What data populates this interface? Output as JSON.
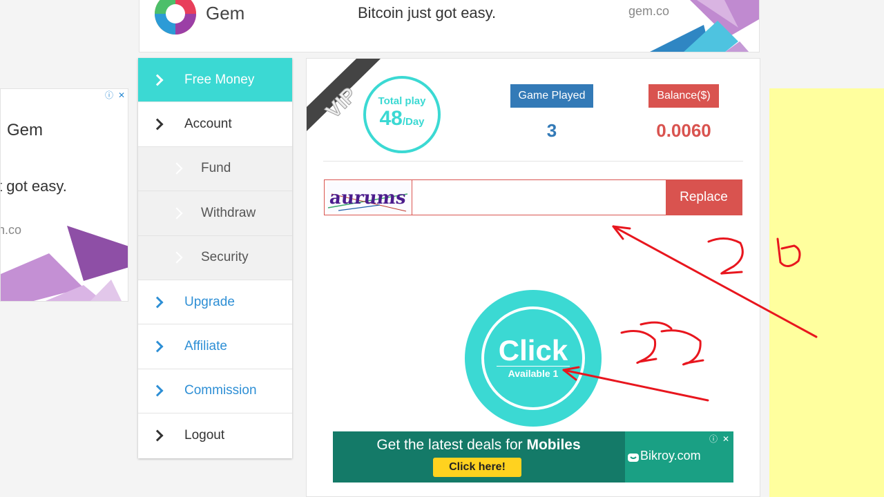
{
  "top_ad": {
    "brand": "Gem",
    "slogan": "Bitcoin just got easy.",
    "domain": "gem.co"
  },
  "left_ad": {
    "brand": "Gem",
    "slogan": "t got easy.",
    "domain": "n.co",
    "adchoices": [
      "ⓘ",
      "✕"
    ]
  },
  "sidebar": {
    "items": [
      {
        "label": "Free Money"
      },
      {
        "label": "Account"
      },
      {
        "label": "Fund"
      },
      {
        "label": "Withdraw"
      },
      {
        "label": "Security"
      },
      {
        "label": "Upgrade"
      },
      {
        "label": "Affiliate"
      },
      {
        "label": "Commission"
      },
      {
        "label": "Logout"
      }
    ]
  },
  "stats": {
    "vip_label": "VIP",
    "total_play_label": "Total play",
    "total_play_value": "48",
    "total_play_unit": "/Day",
    "game_played_label": "Game Played",
    "game_played_value": "3",
    "balance_label": "Balance($)",
    "balance_value": "0.0060"
  },
  "captcha": {
    "text": "aurums",
    "input_value": "",
    "replace_label": "Replace"
  },
  "click_button": {
    "label": "Click",
    "available": "Available 1"
  },
  "bottom_ad": {
    "headline_prefix": "Get the latest deals for ",
    "headline_bold": "Mobiles",
    "cta": "Click here!",
    "site": "Bikroy.com",
    "adchoices": [
      "ⓘ",
      "✕"
    ]
  },
  "colors": {
    "accent": "#3bd9d3",
    "blue": "#337ab7",
    "red": "#d9534f",
    "link": "#2e8fd5",
    "note_yellow": "#ffff9e",
    "annotation": "#e8161e"
  }
}
